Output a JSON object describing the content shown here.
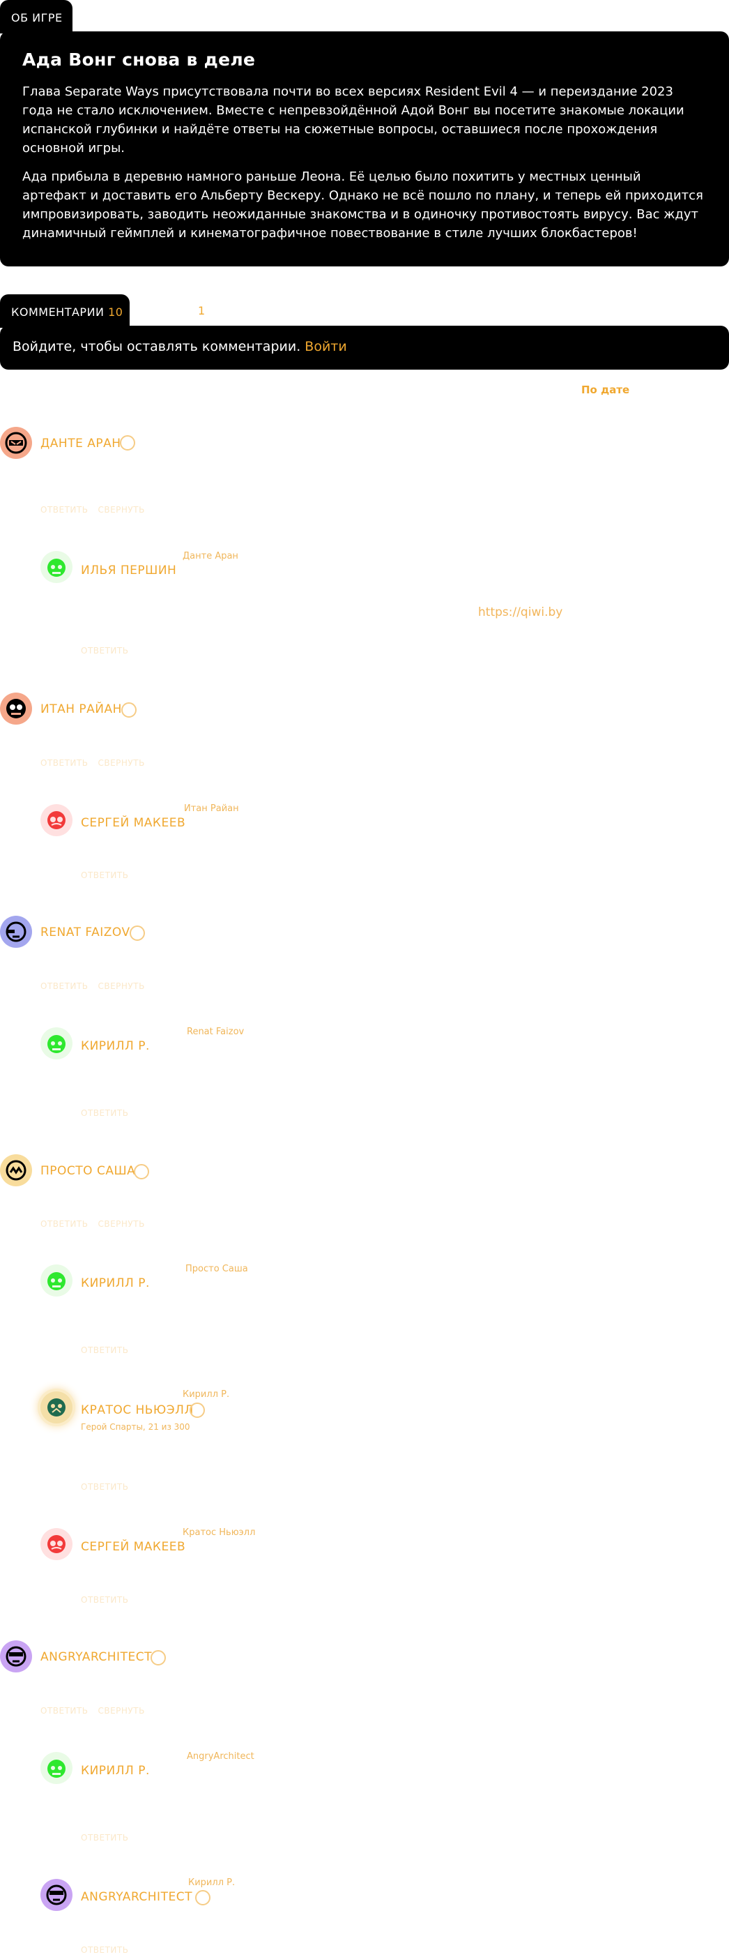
{
  "about": {
    "tab_label": "ОБ ИГРЕ",
    "title": "Ада Вонг снова в деле",
    "paragraphs": [
      "Глава Separate Ways присутствовала почти во всех версиях Resident Evil 4 — и переиздание 2023 года не стало исключением. Вместе с непревзойдённой Адой Вонг вы посетите знакомые локации испанской глубинки и найдёте ответы на сюжетные вопросы, оставшиеся после прохождения основной игры.",
      "Ада прибыла в деревню намного раньше Леона. Её целью было похитить у местных ценный артефакт и доставить его Альберту Вескеру. Однако не всё пошло по плану, и теперь ей приходится импровизировать, заводить неожиданные знакомства и в одиночку противостоять вирусу. Вас ждут динамичный геймплей и кинематографичное повествование в стиле лучших блокбастеров!"
    ]
  },
  "comments_tab": {
    "label": "КОММЕНТАРИИ",
    "count": "10"
  },
  "pagination": {
    "page": "1"
  },
  "login": {
    "text": "Войдите, чтобы оставлять комментарии.",
    "link": "Войти"
  },
  "sort": {
    "label": "По дате"
  },
  "actions": {
    "reply": "ОТВЕТИТЬ",
    "collapse": "СВЕРНУТЬ"
  },
  "comments": [
    {
      "author": "ДАНТЕ АРАН"
    },
    {
      "author": "ИЛЬЯ ПЕРШИН",
      "reply_to": "Данте Аран",
      "link": "https://qiwi.by"
    },
    {
      "author": "ИТАН РАЙАН"
    },
    {
      "author": "СЕРГЕЙ МАКЕЕВ",
      "reply_to": "Итан Райан"
    },
    {
      "author": "RENAT FAIZOV"
    },
    {
      "author": "КИРИЛЛ Р.",
      "reply_to": "Renat Faizov"
    },
    {
      "author": "ПРОСТО САША"
    },
    {
      "author": "КИРИЛЛ Р.",
      "reply_to": "Просто Саша"
    },
    {
      "author": "КРАТОС НЬЮЭЛЛ",
      "reply_to": "Кирилл Р.",
      "rank": "Герой Спарты, 21 из 300"
    },
    {
      "author": "СЕРГЕЙ МАКЕЕВ",
      "reply_to": "Кратос Ньюэлл"
    },
    {
      "author": "ANGRYARCHITECT"
    },
    {
      "author": "КИРИЛЛ Р.",
      "reply_to": "AngryArchitect"
    },
    {
      "author": "ANGRYARCHITECT",
      "reply_to": "Кирилл Р."
    }
  ],
  "colors": {
    "accent": "#f0a830",
    "dark": "#000000"
  },
  "icons": [
    "robot-face-icon"
  ]
}
